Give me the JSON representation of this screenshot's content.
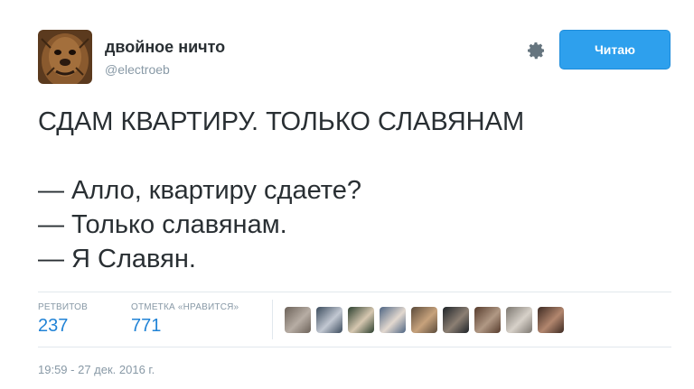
{
  "author": {
    "name": "двойное ничто",
    "handle": "@electroeb"
  },
  "follow_button": {
    "label": "Читаю",
    "color": "#2ea0ed"
  },
  "tweet": {
    "text": "СДАМ КВАРТИРУ. ТОЛЬКО СЛАВЯНАМ\n\n— Алло, квартиру сдаете?\n— Только славянам.\n— Я Славян."
  },
  "stats": {
    "retweets": {
      "label": "РЕТВИТОВ",
      "value": "237"
    },
    "likes": {
      "label": "ОТМЕТКА «НРАВИТСЯ»",
      "value": "771"
    }
  },
  "likers": [
    {
      "name": "liker-avatar-1",
      "colors": [
        "#6b6158",
        "#b7ada4"
      ]
    },
    {
      "name": "liker-avatar-2",
      "colors": [
        "#3a4a5c",
        "#c2c8d2"
      ]
    },
    {
      "name": "liker-avatar-3",
      "colors": [
        "#2b3f2e",
        "#d6c7b0"
      ]
    },
    {
      "name": "liker-avatar-4",
      "colors": [
        "#4e6583",
        "#e2d8cf"
      ]
    },
    {
      "name": "liker-avatar-5",
      "colors": [
        "#5a4a3a",
        "#c7a27c"
      ]
    },
    {
      "name": "liker-avatar-6",
      "colors": [
        "#1e2328",
        "#8c7f73"
      ]
    },
    {
      "name": "liker-avatar-7",
      "colors": [
        "#563b2c",
        "#b09884"
      ]
    },
    {
      "name": "liker-avatar-8",
      "colors": [
        "#7b766f",
        "#d7d1c9"
      ]
    },
    {
      "name": "liker-avatar-9",
      "colors": [
        "#3d2a22",
        "#b2866e"
      ]
    }
  ],
  "timestamp": "19:59 - 27 дек. 2016 г."
}
